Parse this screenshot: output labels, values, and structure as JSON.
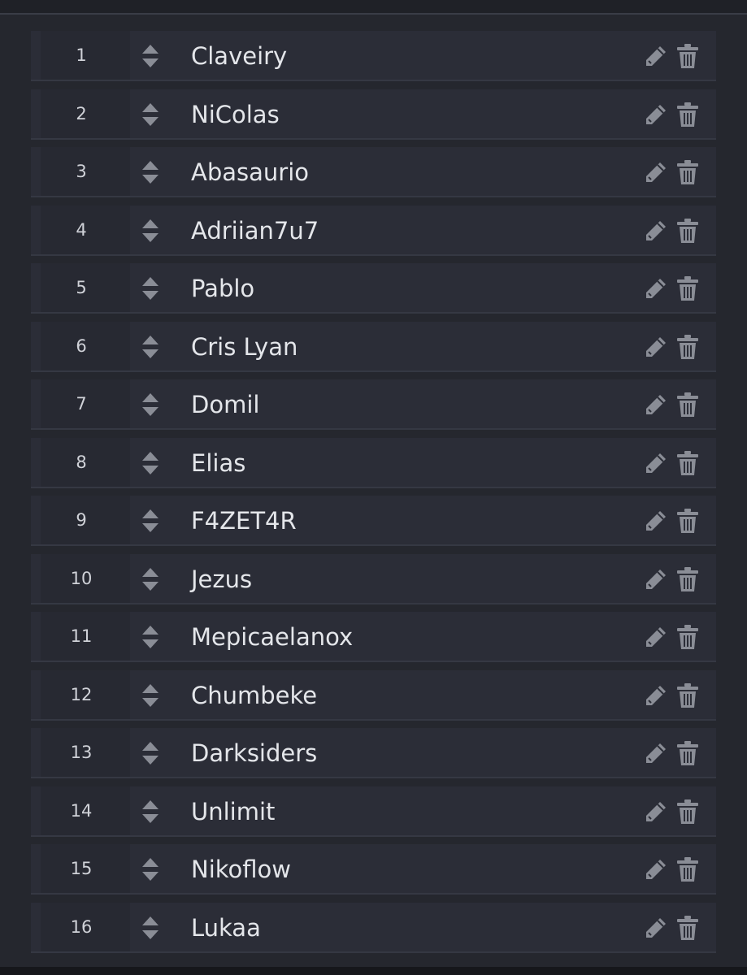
{
  "colors": {
    "background": "#25272e",
    "row_background": "#2b2d37",
    "text": "#e4e6ea",
    "icon": "#8a8d96"
  },
  "icons": {
    "sort": "sort-icon",
    "edit": "pencil-icon",
    "delete": "trash-icon"
  },
  "players": [
    {
      "position": "1",
      "name": "Claveiry"
    },
    {
      "position": "2",
      "name": "NiColas"
    },
    {
      "position": "3",
      "name": "Abasaurio"
    },
    {
      "position": "4",
      "name": "Adriian7u7"
    },
    {
      "position": "5",
      "name": "Pablo"
    },
    {
      "position": "6",
      "name": "Cris Lyan"
    },
    {
      "position": "7",
      "name": "Domil"
    },
    {
      "position": "8",
      "name": "Elias"
    },
    {
      "position": "9",
      "name": "F4ZET4R"
    },
    {
      "position": "10",
      "name": "Jezus"
    },
    {
      "position": "11",
      "name": "Mepicaelanox"
    },
    {
      "position": "12",
      "name": "Chumbeke"
    },
    {
      "position": "13",
      "name": "Darksiders"
    },
    {
      "position": "14",
      "name": "Unlimit"
    },
    {
      "position": "15",
      "name": "Nikoflow"
    },
    {
      "position": "16",
      "name": "Lukaa"
    }
  ]
}
